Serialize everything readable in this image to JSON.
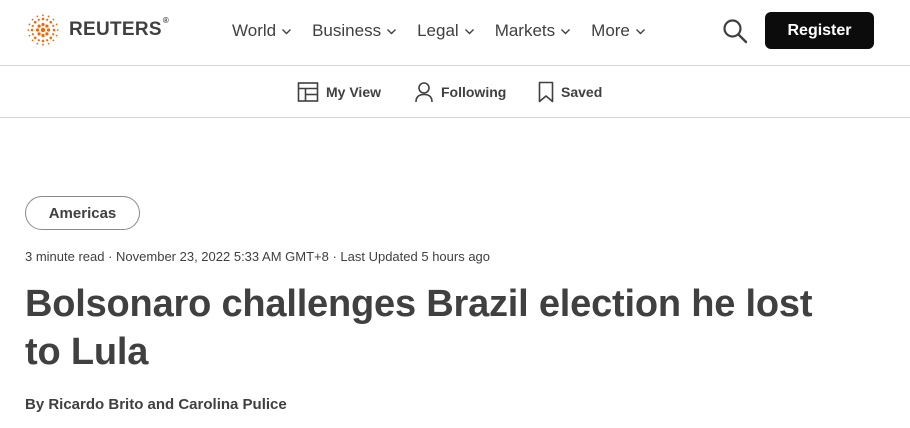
{
  "brand": {
    "name": "REUTERS",
    "registered_mark": "®",
    "accent_color": "#fa6400",
    "text_color": "#404040"
  },
  "nav": {
    "items": [
      {
        "label": "World",
        "icon": "chevron-down-icon"
      },
      {
        "label": "Business",
        "icon": "chevron-down-icon"
      },
      {
        "label": "Legal",
        "icon": "chevron-down-icon"
      },
      {
        "label": "Markets",
        "icon": "chevron-down-icon"
      },
      {
        "label": "More",
        "icon": "chevron-down-icon"
      }
    ],
    "search_icon": "search-icon",
    "register_label": "Register",
    "register_color": "#0c0c0c"
  },
  "subnav": {
    "my_view": {
      "label": "My View",
      "icon": "layout-icon"
    },
    "following": {
      "label": "Following",
      "icon": "person-icon"
    },
    "saved": {
      "label": "Saved",
      "icon": "bookmark-icon"
    }
  },
  "article": {
    "section_tag": "Americas",
    "meta": "3 minute read · November 23, 2022 5:33 AM GMT+8 · Last Updated 5 hours ago",
    "headline": "Bolsonaro challenges Brazil election he lost to Lula",
    "byline": "By Ricardo Brito and Carolina Pulice"
  }
}
